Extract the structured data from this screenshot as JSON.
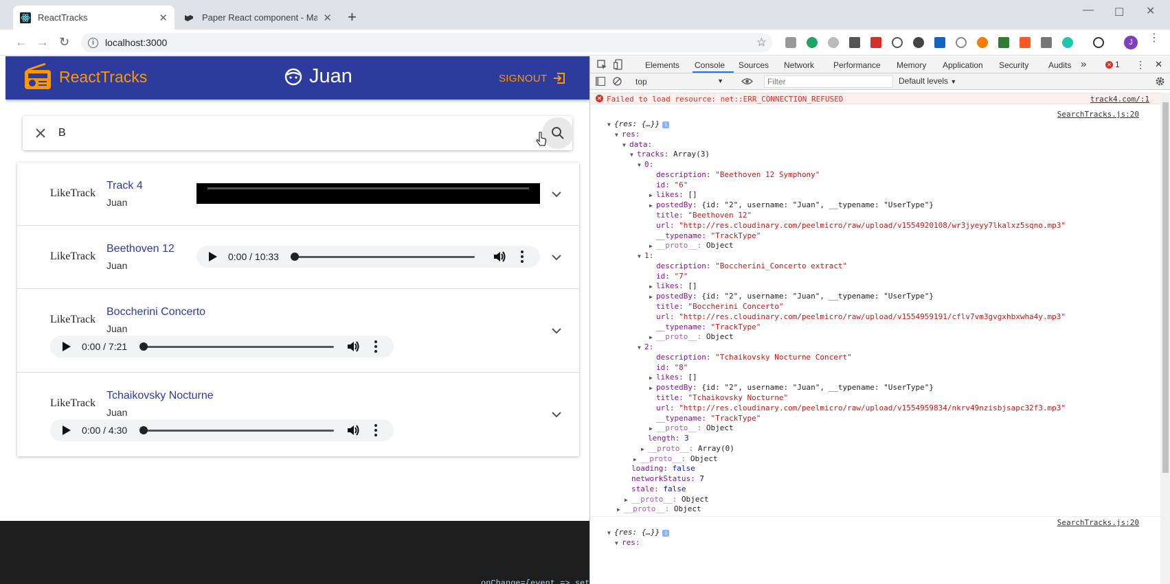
{
  "browser": {
    "tabs": [
      {
        "title": "ReactTracks",
        "active": true
      },
      {
        "title": "Paper React component - Materi",
        "active": false
      }
    ],
    "new_tab": "+",
    "url": "localhost:3000",
    "profile_initial": "J"
  },
  "app": {
    "brand": "ReactTracks",
    "user": "Juan",
    "signout": "SIGNOUT",
    "search_value": "B",
    "fab_label": "+",
    "colors": {
      "primary": "#2d3b9c",
      "accent": "#ff9800"
    },
    "tracks": [
      {
        "like": "LikeTrack",
        "title": "Track 4",
        "user": "Juan",
        "player": "blocked"
      },
      {
        "like": "LikeTrack",
        "title": "Beethoven 12",
        "user": "Juan",
        "player": "inline",
        "time": "0:00 / 10:33"
      },
      {
        "like": "LikeTrack",
        "title": "Boccherini Concerto",
        "user": "Juan",
        "player": "below",
        "time": "0:00 / 7:21"
      },
      {
        "like": "LikeTrack",
        "title": "Tchaikovsky Nocturne",
        "user": "Juan",
        "player": "below",
        "time": "0:00 / 4:30"
      }
    ],
    "bottom_code": "onChange={event => setSearch(event.target.value)}"
  },
  "devtools": {
    "tabs": [
      "Elements",
      "Console",
      "Sources",
      "Network",
      "Performance",
      "Memory",
      "Application",
      "Security",
      "Audits"
    ],
    "more": "»",
    "error_count": "1",
    "context": "top",
    "filter_placeholder": "Filter",
    "levels": "Default levels",
    "error": {
      "message": "Failed to load resource: net::ERR_CONNECTION_REFUSED",
      "source": "track4.com/:1"
    },
    "source_link": "SearchTracks.js:20",
    "tracks": [
      {
        "index": "0",
        "description": "\"Beethoven 12 Symphony\"",
        "id": "\"6\"",
        "title": "\"Beethoven 12\"",
        "url": "\"http://res.cloudinary.com/peelmicro/raw/upload/v1554920108/wr3jyeyy7lkalxz5sqno.mp3\""
      },
      {
        "index": "1",
        "description": "\"Boccherini_Concerto extract\"",
        "id": "\"7\"",
        "title": "\"Boccherini Concerto\"",
        "url": "\"http://res.cloudinary.com/peelmicro/raw/upload/v1554959191/cflv7vm3gvgxhbxwha4y.mp3\""
      },
      {
        "index": "2",
        "description": "\"Tchaikovsky Nocturne Concert\"",
        "id": "\"8\"",
        "title": "\"Tchaikovsky Nocturne\"",
        "url": "\"http://res.cloudinary.com/peelmicro/raw/upload/v1554959834/nkrv49nzisbjsapc32f3.mp3\""
      }
    ],
    "text": {
      "res_obj": "{res: {…}}",
      "res": "res:",
      "data": "data:",
      "tracks_label": "tracks:",
      "tracks_value": "Array(3)",
      "description": "description:",
      "id": "id:",
      "likes": "likes:",
      "likes_value": "[]",
      "postedBy": "postedBy:",
      "postedBy_value": "{id: \"2\", username: \"Juan\", __typename: \"UserType\"}",
      "title": "title:",
      "url": "url:",
      "typename": "__typename:",
      "typename_value": "\"TrackType\"",
      "proto": "__proto__:",
      "proto_object": "Object",
      "proto_array": "Array(0)",
      "length": "length:",
      "length_value": "3",
      "loading": "loading:",
      "loading_value": "false",
      "networkStatus": "networkStatus:",
      "networkStatus_value": "7",
      "stale": "stale:",
      "stale_value": "false"
    }
  }
}
